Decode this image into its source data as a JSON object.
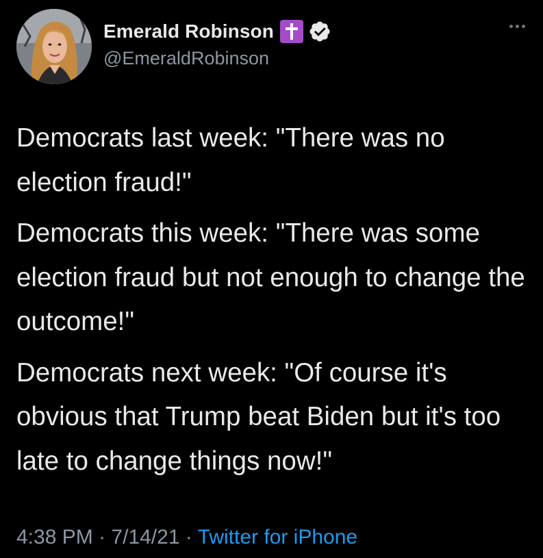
{
  "author": {
    "display_name": "Emerald Robinson",
    "handle": "@EmeraldRobinson",
    "badge_icon": "cross-icon",
    "verified_icon": "verified-badge-icon"
  },
  "tweet": {
    "paragraphs": [
      "Democrats last week: \"There was no election fraud!\"",
      "Democrats this week: \"There was some election fraud but not enough to change the outcome!\"",
      "Democrats next week: \"Of course it's obvious that Trump beat Biden but it's too late to change things now!\""
    ],
    "time": "4:38 PM",
    "date": "7/14/21",
    "separator": "·",
    "source": "Twitter for iPhone"
  },
  "colors": {
    "background": "#000000",
    "text": "#e7e9ea",
    "secondary_text": "#8b98a5",
    "link": "#1d9bf0",
    "cross_badge": "#a44cc8"
  }
}
